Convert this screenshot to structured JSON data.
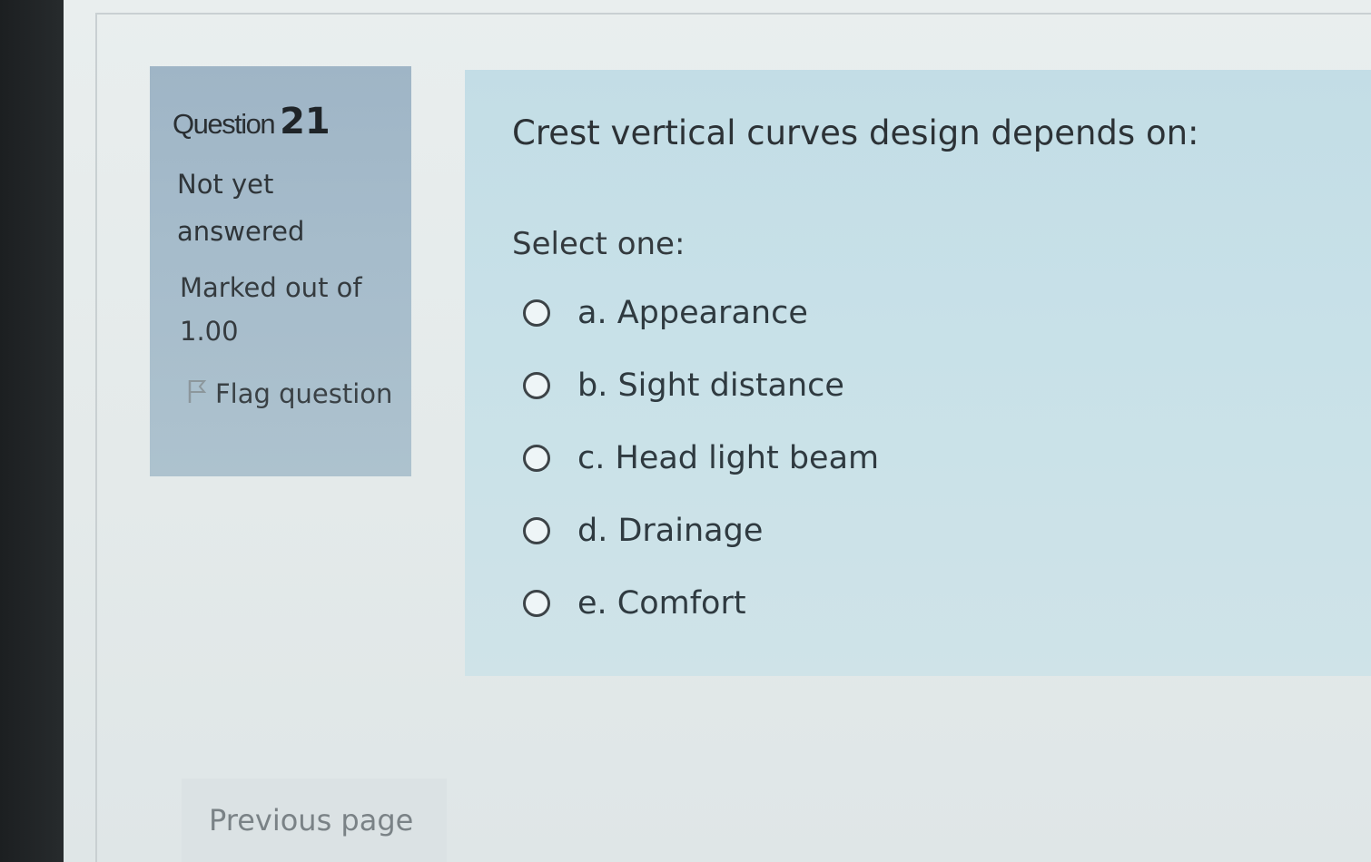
{
  "question_info": {
    "label": "Question",
    "number": "21",
    "state": "Not yet answered",
    "grade": "Marked out of 1.00",
    "flag_label": "Flag question"
  },
  "question": {
    "text": "Crest vertical curves design depends on:",
    "prompt": "Select one:",
    "answers": [
      {
        "label": "a. Appearance"
      },
      {
        "label": "b. Sight distance"
      },
      {
        "label": "c. Head light beam"
      },
      {
        "label": "d. Drainage"
      },
      {
        "label": "e. Comfort"
      }
    ]
  },
  "navigation": {
    "previous_label": "Previous page"
  },
  "icons": {
    "flag": "flag-icon",
    "radio": "radio-button-unchecked"
  },
  "colors": {
    "info_background": "#a6bccb",
    "content_background": "#c8e1e8",
    "page_background": "#e6ecec"
  }
}
